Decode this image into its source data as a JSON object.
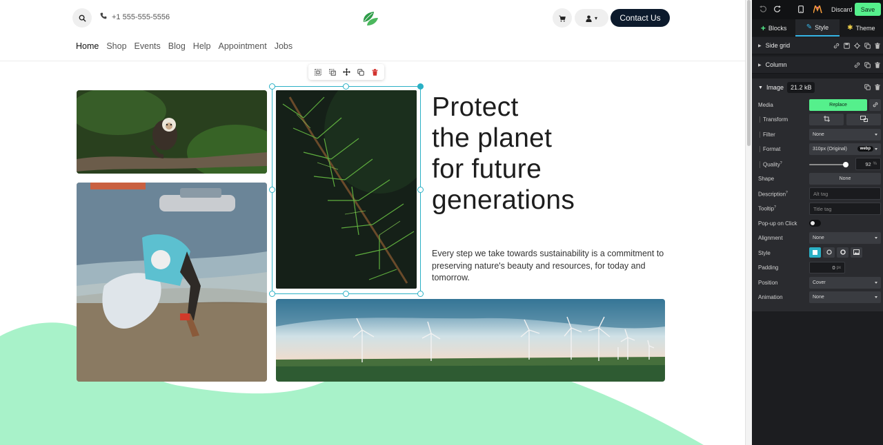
{
  "header": {
    "phone": "+1 555-555-5556",
    "contact_label": "Contact Us",
    "user_caret": "▾"
  },
  "nav": {
    "items": [
      "Home",
      "Shop",
      "Events",
      "Blog",
      "Help",
      "Appointment",
      "Jobs"
    ],
    "active": "Home"
  },
  "hero": {
    "title_lines": [
      "Protect",
      "the planet",
      "for future",
      "generations"
    ],
    "text": "Every step we take towards sustainability is a commitment to preserving nature's beauty and resources, for today and tomorrow."
  },
  "editor": {
    "topbar": {
      "discard": "Discard",
      "save": "Save"
    },
    "tabs": {
      "blocks": "Blocks",
      "style": "Style",
      "theme": "Theme",
      "active": "Style"
    },
    "sections": {
      "side_grid": "Side grid",
      "column": "Column"
    },
    "image": {
      "title": "Image",
      "size": "21.2 kB",
      "media_label": "Media",
      "replace_label": "Replace",
      "transform_label": "Transform",
      "filter_label": "Filter",
      "filter_value": "None",
      "format_label": "Format",
      "format_value": "310px (Original)",
      "format_badge": "webp",
      "quality_label": "Quality",
      "quality_sup": "?",
      "quality_value": "92",
      "quality_unit": "%",
      "shape_label": "Shape",
      "shape_value": "None",
      "description_label": "Description",
      "description_sup": "?",
      "description_placeholder": "Alt tag",
      "tooltip_label": "Tooltip",
      "tooltip_sup": "?",
      "tooltip_placeholder": "Title tag",
      "popup_label": "Pop-up on Click",
      "popup_enabled": false,
      "alignment_label": "Alignment",
      "alignment_value": "None",
      "style_label": "Style",
      "padding_label": "Padding",
      "padding_value": "0",
      "padding_unit": "px",
      "position_label": "Position",
      "position_value": "Cover",
      "animation_label": "Animation",
      "animation_value": "None"
    }
  },
  "colors": {
    "accent_green": "#55f08c",
    "selection_teal": "#2ab0c5",
    "panel_bg": "#1c1d20",
    "contact_bg": "#0c1a2c",
    "wave": "#a8f2c9"
  },
  "icons": {
    "search": "search-icon",
    "phone": "phone-icon",
    "cart": "cart-icon",
    "user": "user-icon",
    "logo": "leaf-logo-icon"
  }
}
